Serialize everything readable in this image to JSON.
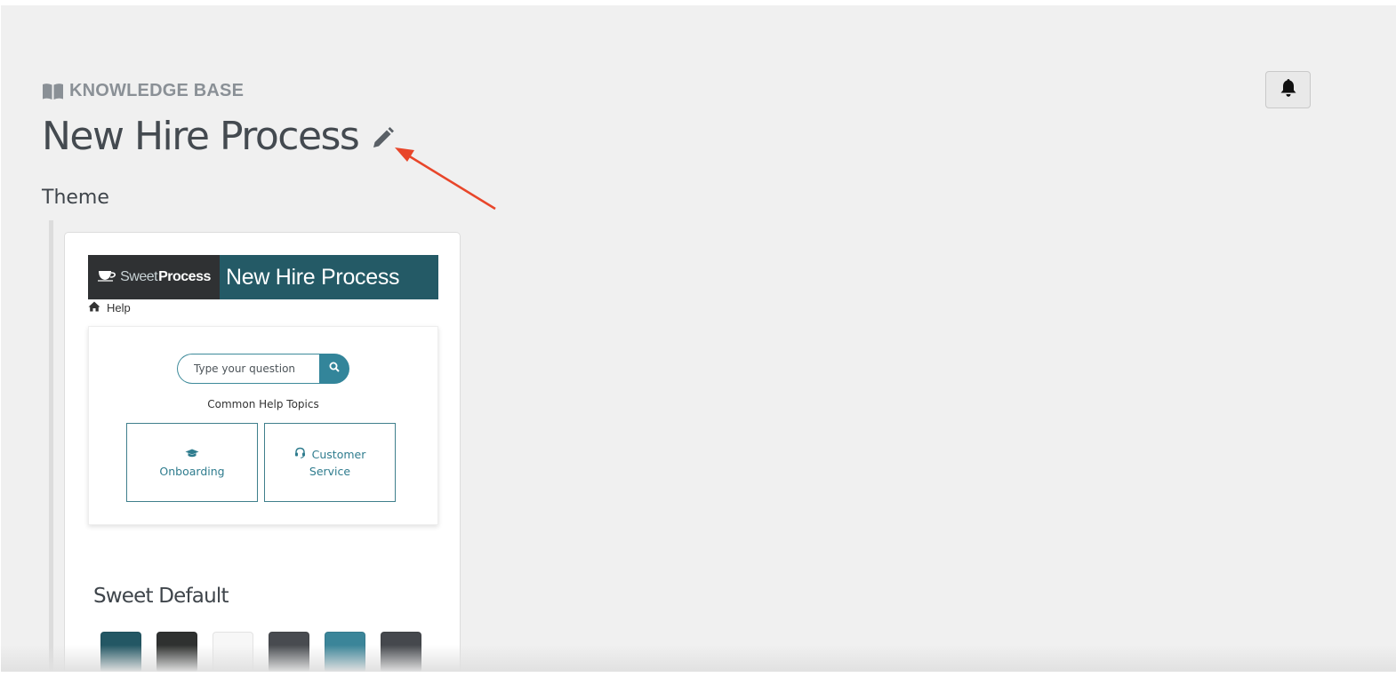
{
  "header": {
    "section_label": "KNOWLEDGE BASE",
    "title": "New Hire Process",
    "icons": {
      "section": "book-icon",
      "edit": "pencil-icon",
      "notifications": "bell-icon"
    }
  },
  "theme_section": {
    "title": "Theme"
  },
  "theme_card": {
    "preview": {
      "brand_sweet": "Sweet",
      "brand_process": "Process",
      "kb_title": "New Hire Process",
      "breadcrumb": "Help",
      "search_placeholder": "Type your question",
      "topics_heading": "Common Help Topics",
      "topics": [
        {
          "label": "Onboarding",
          "icon": "graduation-cap-icon"
        },
        {
          "label_line1": "Customer",
          "label_line2": "Service",
          "icon": "headset-icon"
        }
      ],
      "colors": {
        "header_dark": "#2f3133",
        "header_teal": "#245a66",
        "accent": "#33859a"
      }
    },
    "name": "Sweet Default",
    "swatches": [
      "#235764",
      "#2f3130",
      "#f7f7f7",
      "#484b50",
      "#3b8599",
      "#45484d"
    ]
  },
  "annotation": {
    "arrow_color": "#e8462a"
  }
}
